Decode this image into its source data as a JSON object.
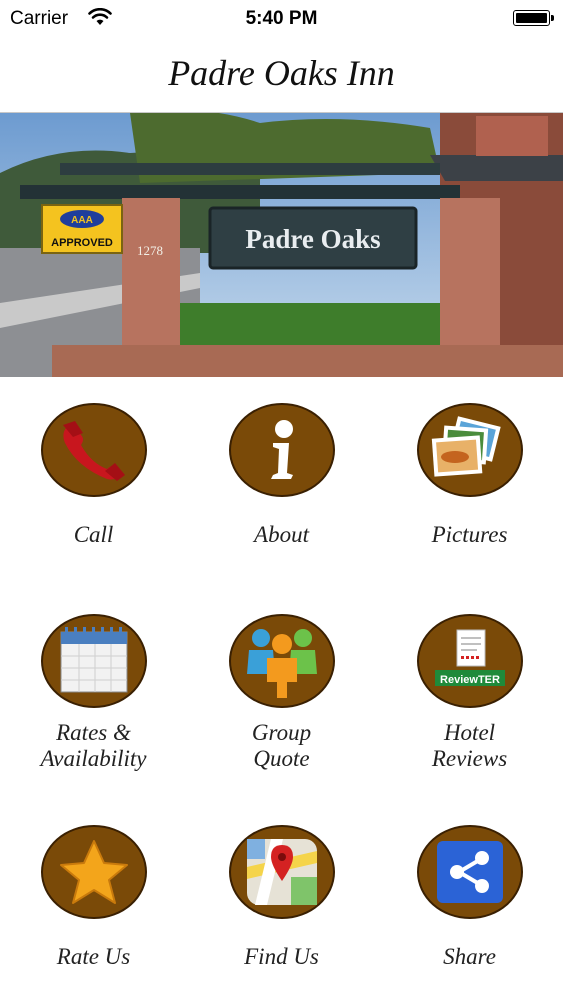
{
  "status_bar": {
    "carrier": "Carrier",
    "time": "5:40 PM"
  },
  "header": {
    "title": "Padre Oaks Inn"
  },
  "hero": {
    "sign_text": "Padre Oaks",
    "badge_text": "APPROVED",
    "badge_logo": "AAA",
    "address_number": "1278"
  },
  "menu": [
    {
      "label": "Call",
      "icon": "phone-icon"
    },
    {
      "label": "About",
      "icon": "info-icon"
    },
    {
      "label": "Pictures",
      "icon": "photos-icon"
    },
    {
      "label": "Rates &\nAvailability",
      "icon": "calendar-icon"
    },
    {
      "label": "Group\nQuote",
      "icon": "group-icon"
    },
    {
      "label": "Hotel\nReviews",
      "icon": "reviewter-icon",
      "icon_text": "ReviewTER"
    },
    {
      "label": "Rate Us",
      "icon": "star-icon"
    },
    {
      "label": "Find Us",
      "icon": "map-pin-icon"
    },
    {
      "label": "Share",
      "icon": "share-icon"
    }
  ],
  "colors": {
    "circle_fill": "#7a4a08",
    "circle_border": "#3a2002",
    "phone_red": "#c8161e",
    "star_orange": "#f3a51b",
    "share_blue": "#2b63d6"
  }
}
